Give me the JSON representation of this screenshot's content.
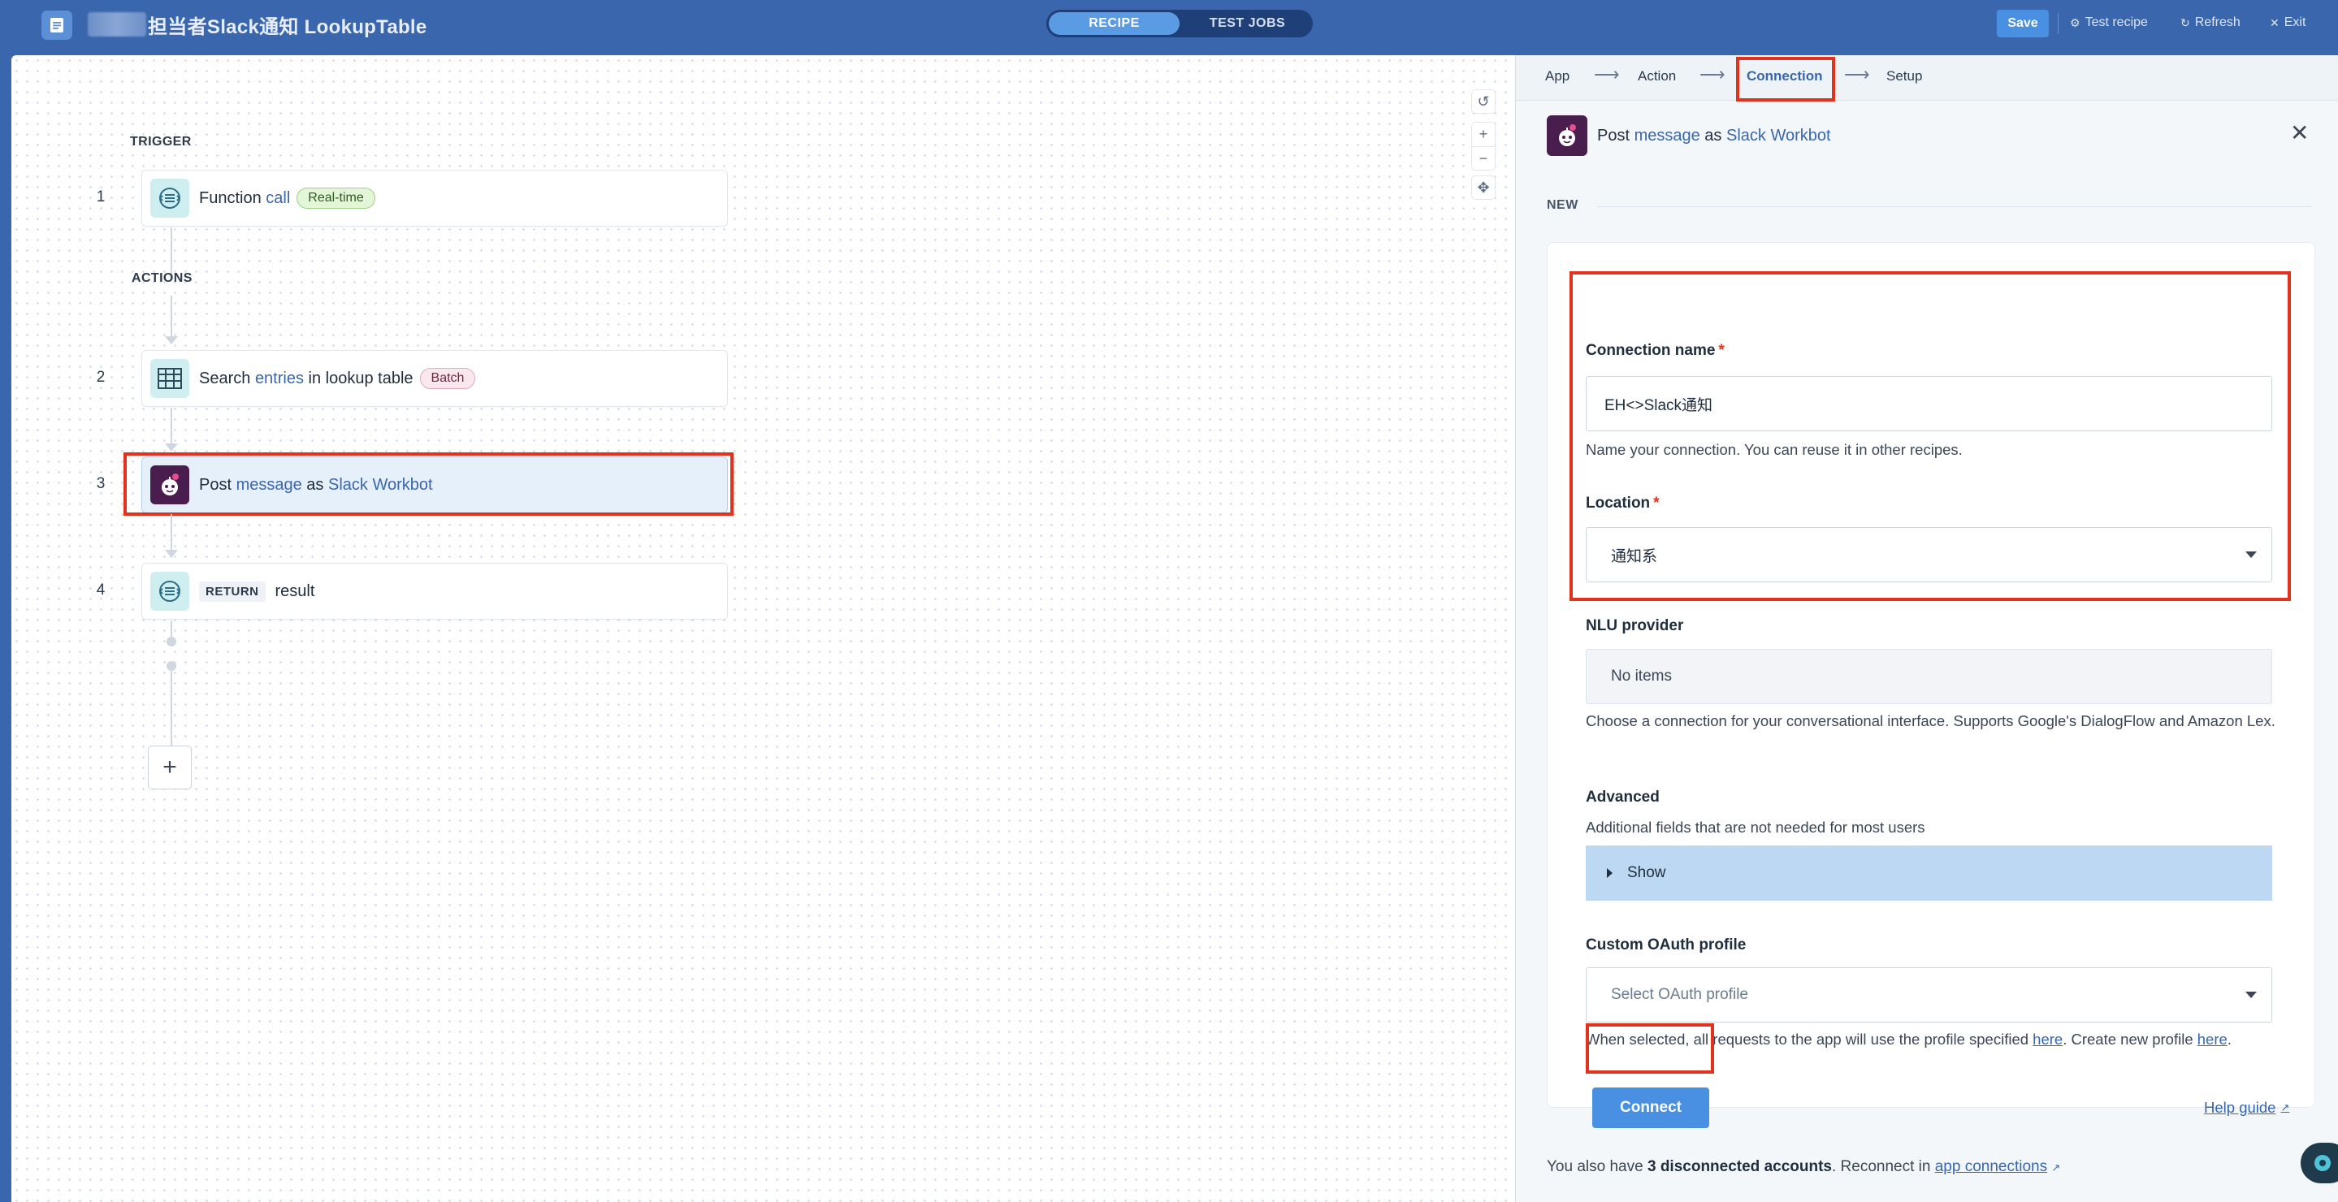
{
  "topbar": {
    "title": "担当者Slack通知 LookupTable",
    "tabs": [
      "RECIPE",
      "TEST JOBS"
    ],
    "save_label": "Save",
    "test_recipe_label": "Test recipe",
    "refresh_label": "Refresh",
    "exit_label": "Exit"
  },
  "canvas": {
    "trigger_label": "TRIGGER",
    "actions_label": "ACTIONS",
    "steps": [
      {
        "num": "1",
        "pre": "Function ",
        "kw": "call",
        "post": "",
        "badge": "Real-time"
      },
      {
        "num": "2",
        "pre": "Search ",
        "kw": "entries",
        "post": " in lookup table",
        "badge": "Batch"
      },
      {
        "num": "3",
        "pre": "Post ",
        "kw": "message",
        "mid": " as ",
        "kw2": "Slack Workbot"
      },
      {
        "num": "4",
        "tag": "RETURN",
        "post": "result"
      }
    ],
    "add_label": "+"
  },
  "wizard": {
    "steps": [
      "App",
      "Action",
      "Connection",
      "Setup"
    ],
    "active": "Connection"
  },
  "panel": {
    "header_pre": "Post ",
    "header_kw": "message",
    "header_mid": " as ",
    "header_kw2": "Slack Workbot",
    "new_label": "NEW",
    "connection_name": {
      "label": "Connection name",
      "value": "EH<>Slack通知",
      "hint": "Name your connection. You can reuse it in other recipes."
    },
    "location": {
      "label": "Location",
      "value": "通知系"
    },
    "nlu": {
      "label": "NLU provider",
      "value": "No items",
      "hint": "Choose a connection for your conversational interface. Supports Google's DialogFlow and Amazon Lex."
    },
    "advanced": {
      "label": "Advanced",
      "hint": "Additional fields that are not needed for most users",
      "show_label": "Show"
    },
    "oauth": {
      "label": "Custom OAuth profile",
      "placeholder": "Select OAuth profile",
      "hint_pre": "When selected, all requests to the app will use the profile specified ",
      "hint_link1": "here",
      "hint_mid": ". Create new profile ",
      "hint_link2": "here",
      "hint_post": "."
    },
    "connect_label": "Connect",
    "help_label": "Help guide",
    "footer_pre": "You also have ",
    "footer_bold": "3 disconnected accounts",
    "footer_mid": ". Reconnect in ",
    "footer_link": "app connections"
  },
  "colors": {
    "topbar_bg": "#3a66ad",
    "accent": "#4a90e2",
    "highlight_red": "#e0321c",
    "slack_purple": "#4a1d4f"
  }
}
